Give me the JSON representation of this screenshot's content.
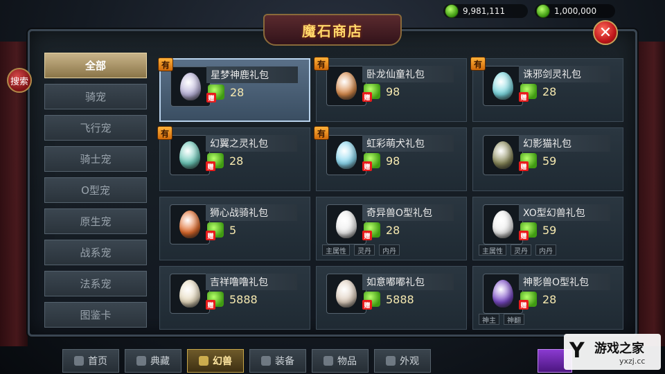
{
  "currency": {
    "primary": "9,981,111",
    "secondary": "1,000,000"
  },
  "shop": {
    "title": "魔石商店",
    "search_label": "搜索",
    "close_label": "✕"
  },
  "categories": [
    {
      "label": "全部"
    },
    {
      "label": "骑宠"
    },
    {
      "label": "飞行宠"
    },
    {
      "label": "骑士宠"
    },
    {
      "label": "O型宠"
    },
    {
      "label": "原生宠"
    },
    {
      "label": "战系宠"
    },
    {
      "label": "法系宠"
    },
    {
      "label": "图鉴卡"
    }
  ],
  "items": [
    {
      "name": "星梦神鹿礼包",
      "price": "28",
      "hot": "有",
      "gift": "赠",
      "egg_color": "#b9b2d9",
      "tags": []
    },
    {
      "name": "卧龙仙童礼包",
      "price": "98",
      "hot": "有",
      "gift": "赠",
      "egg_color": "#d88a4a",
      "tags": []
    },
    {
      "name": "诛邪剑灵礼包",
      "price": "28",
      "hot": "有",
      "gift": "赠",
      "egg_color": "#7ad8e0",
      "tags": []
    },
    {
      "name": "幻翼之灵礼包",
      "price": "28",
      "hot": "有",
      "gift": "赠",
      "egg_color": "#6ac8b8",
      "tags": []
    },
    {
      "name": "虹彩萌犬礼包",
      "price": "98",
      "hot": "有",
      "gift": "赠",
      "egg_color": "#8ad8f0",
      "tags": []
    },
    {
      "name": "幻影猫礼包",
      "price": "59",
      "hot": "",
      "gift": "赠",
      "egg_color": "#8a8a5a",
      "tags": []
    },
    {
      "name": "狮心战骑礼包",
      "price": "5",
      "hot": "",
      "gift": "赠",
      "egg_color": "#e06a2a",
      "tags": []
    },
    {
      "name": "奇异兽O型礼包",
      "price": "28",
      "hot": "",
      "gift": "赠",
      "egg_color": "#eeeeee",
      "tags": [
        "主属性",
        "灵丹",
        "内丹"
      ]
    },
    {
      "name": "XO型幻兽礼包",
      "price": "59",
      "hot": "",
      "gift": "赠",
      "egg_color": "#eeeeee",
      "tags": [
        "主属性",
        "灵丹",
        "内丹"
      ]
    },
    {
      "name": "吉祥噜噜礼包",
      "price": "5888",
      "hot": "",
      "gift": "赠",
      "egg_color": "#e8dcc0",
      "tags": []
    },
    {
      "name": "如意嘟嘟礼包",
      "price": "5888",
      "hot": "",
      "gift": "赠",
      "egg_color": "#e0d0c0",
      "tags": []
    },
    {
      "name": "神影兽O型礼包",
      "price": "28",
      "hot": "",
      "gift": "赠",
      "egg_color": "#7a4ac8",
      "tags": [
        "神主",
        "神翻"
      ]
    }
  ],
  "bottom_nav": [
    {
      "label": "首页"
    },
    {
      "label": "典藏"
    },
    {
      "label": "幻兽"
    },
    {
      "label": "装备"
    },
    {
      "label": "物品"
    },
    {
      "label": "外观"
    }
  ],
  "watermark": {
    "mark": "Y",
    "brand": "游戏之家",
    "url": "yxzj.cc"
  },
  "colors": {
    "title_gold": "#ffd86b",
    "active_category": "#c9b48a",
    "price_text": "#f6e9b0",
    "selected_card_border": "#b8d2ec"
  }
}
